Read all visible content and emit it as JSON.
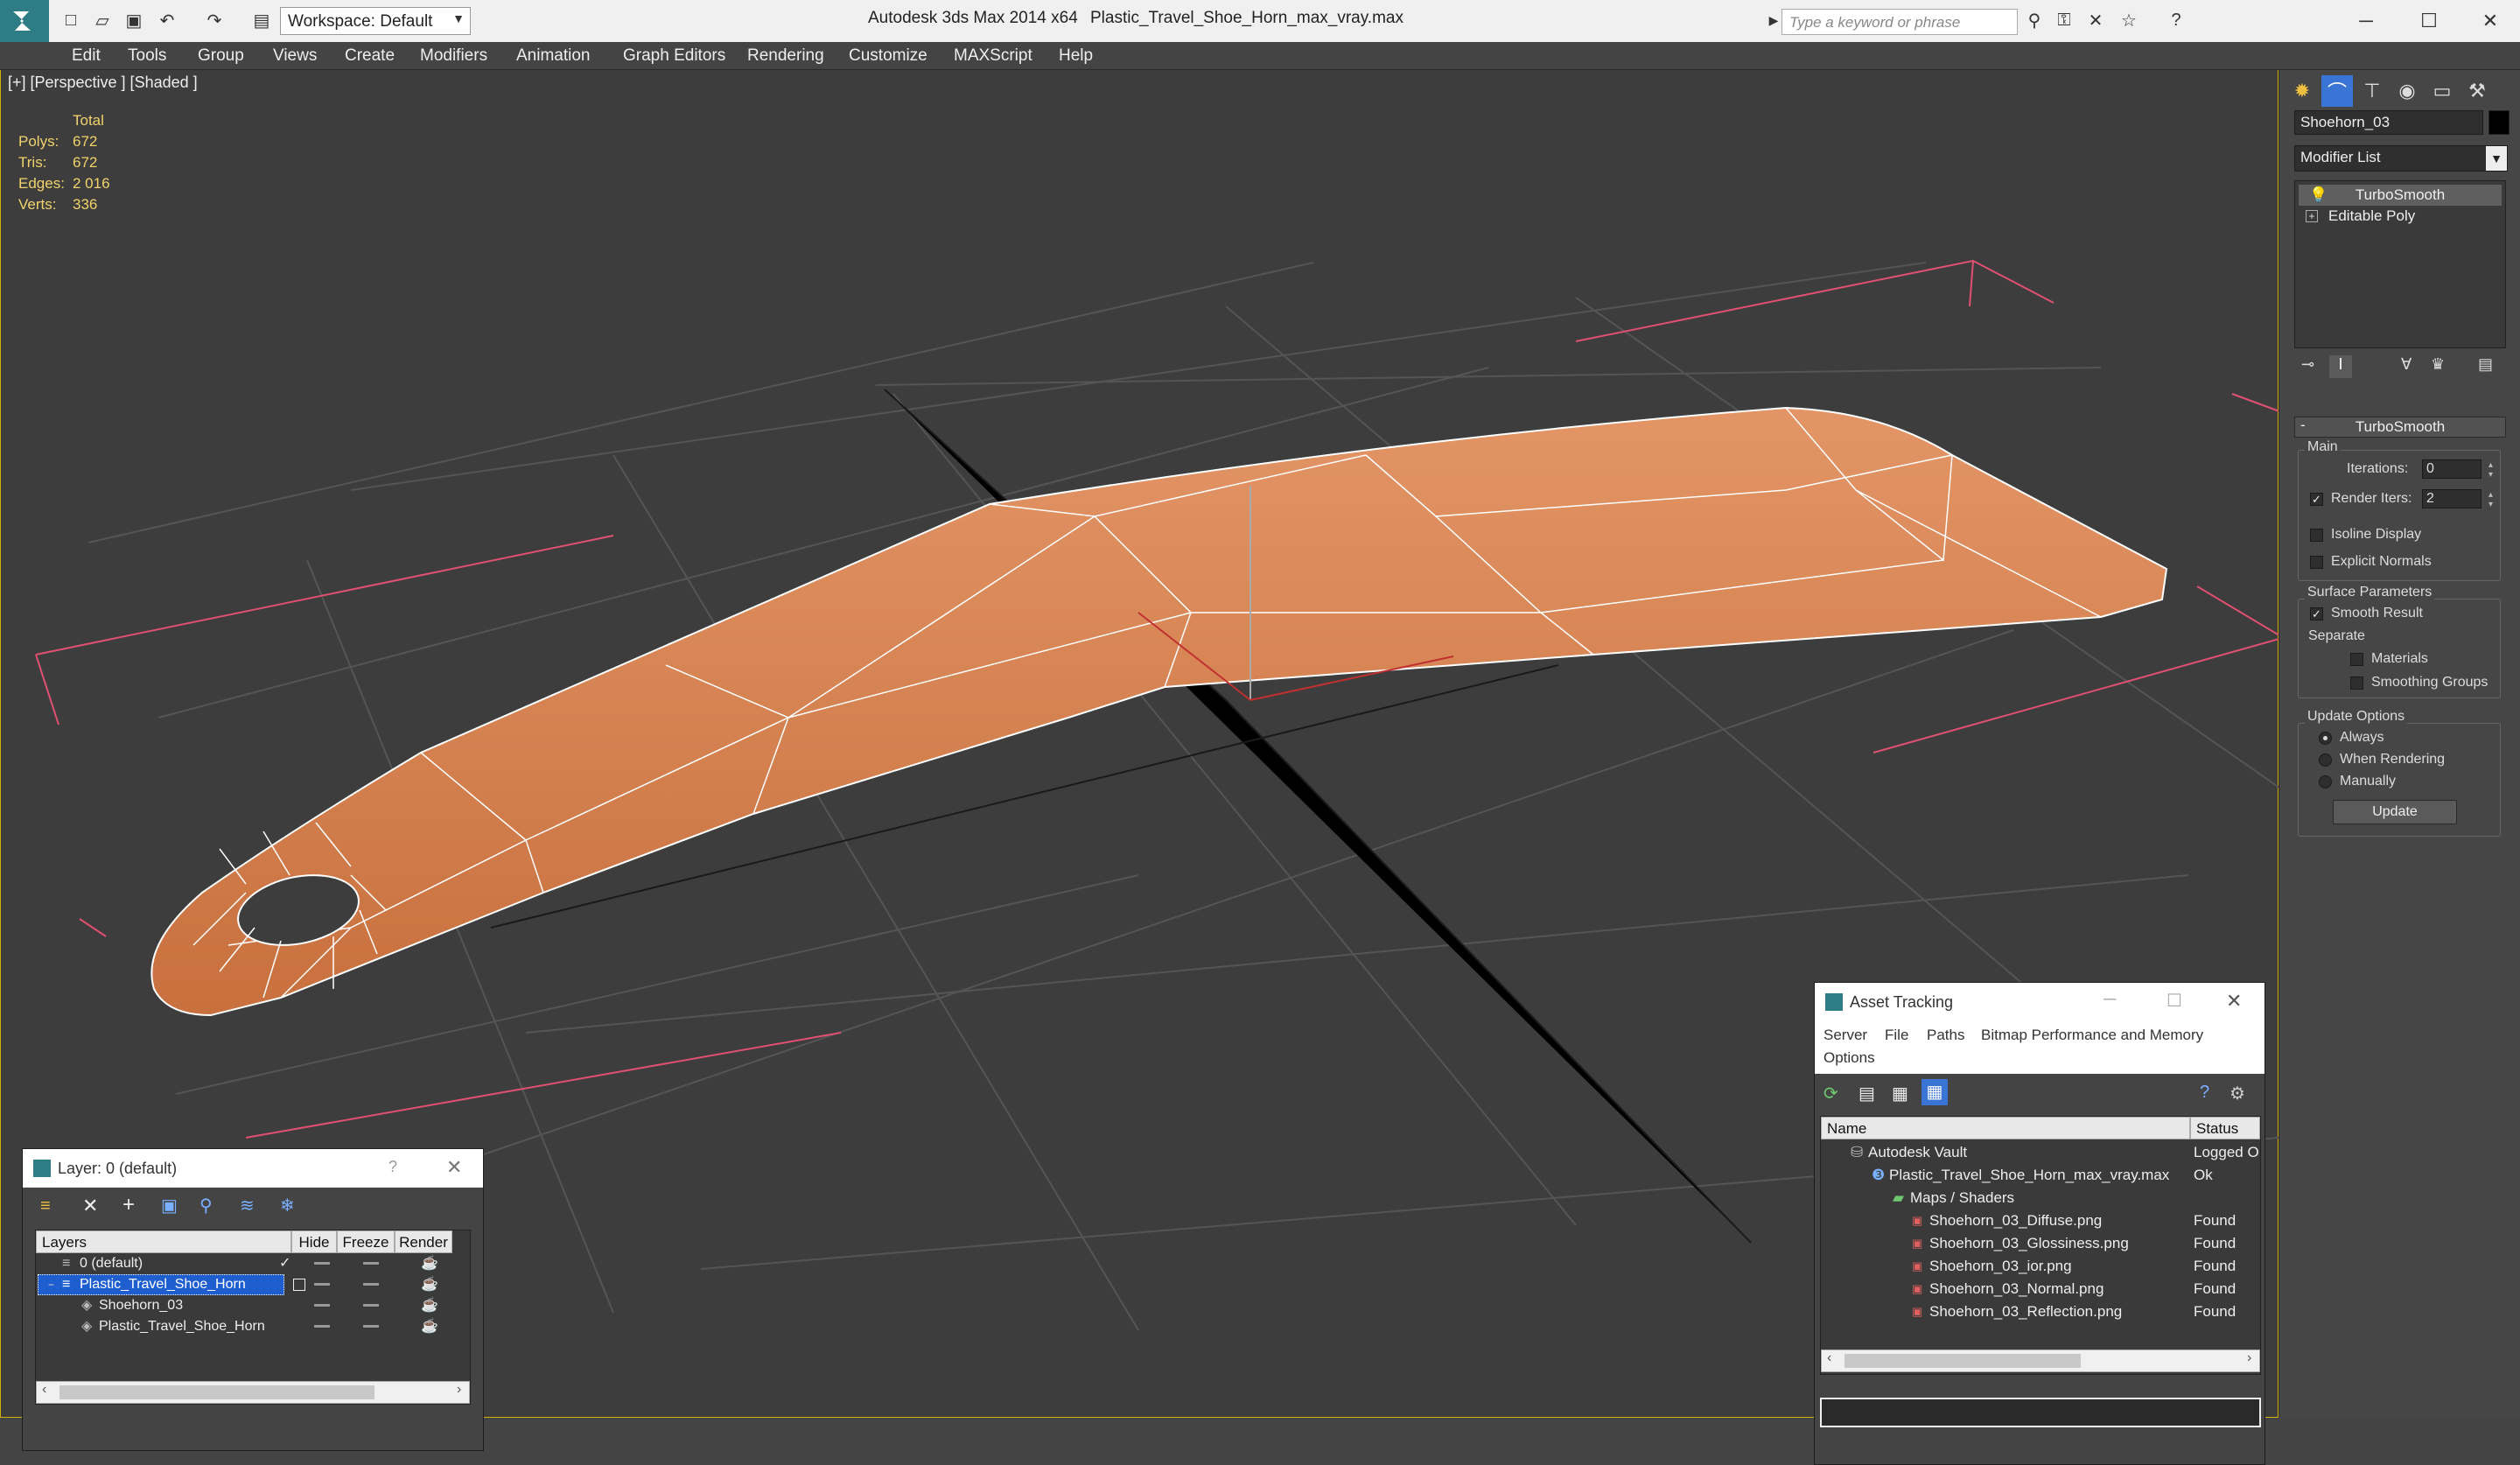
{
  "app": {
    "title": "Autodesk 3ds Max 2014 x64",
    "filename": "Plastic_Travel_Shoe_Horn_max_vray.max",
    "workspace": "Workspace: Default",
    "search_placeholder": "Type a keyword or phrase"
  },
  "menu": [
    "Edit",
    "Tools",
    "Group",
    "Views",
    "Create",
    "Modifiers",
    "Animation",
    "Graph Editors",
    "Rendering",
    "Customize",
    "MAXScript",
    "Help"
  ],
  "viewport": {
    "label": "[+] [Perspective ] [Shaded ]",
    "stats": {
      "header": "Total",
      "rows": [
        {
          "label": "Polys:",
          "value": "672"
        },
        {
          "label": "Tris:",
          "value": "672"
        },
        {
          "label": "Edges:",
          "value": "2 016"
        },
        {
          "label": "Verts:",
          "value": "336"
        }
      ]
    },
    "object_color": "#d9824f"
  },
  "command_panel": {
    "object_name": "Shoehorn_03",
    "modifier_list": "Modifier List",
    "stack": [
      "TurboSmooth",
      "Editable Poly"
    ],
    "rollout": {
      "title": "TurboSmooth",
      "main": "Main",
      "iterations_label": "Iterations:",
      "iterations_value": "0",
      "render_iters_label": "Render Iters:",
      "render_iters_value": "2",
      "render_iters_checked": true,
      "isoline_display": "Isoline Display",
      "explicit_normals": "Explicit Normals",
      "surface_parameters": "Surface Parameters",
      "smooth_result": "Smooth Result",
      "separate": "Separate",
      "materials": "Materials",
      "smoothing_groups": "Smoothing Groups",
      "update_options": "Update Options",
      "always": "Always",
      "when_rendering": "When Rendering",
      "manually": "Manually",
      "update_button": "Update"
    }
  },
  "layer_dialog": {
    "title": "Layer: 0 (default)",
    "help": "?",
    "columns": [
      "Layers",
      "Hide",
      "Freeze",
      "Render"
    ],
    "rows": [
      "0 (default)",
      "Plastic_Travel_Shoe_Horn",
      "Shoehorn_03",
      "Plastic_Travel_Shoe_Horn"
    ]
  },
  "asset_tracking": {
    "title": "Asset Tracking",
    "menu": [
      "Server",
      "File",
      "Paths",
      "Bitmap Performance and Memory",
      "Options"
    ],
    "columns": [
      "Name",
      "Status"
    ],
    "rows": [
      {
        "name": "Autodesk Vault",
        "status": "Logged O"
      },
      {
        "name": "Plastic_Travel_Shoe_Horn_max_vray.max",
        "status": "Ok"
      },
      {
        "name": "Maps / Shaders",
        "status": ""
      },
      {
        "name": "Shoehorn_03_Diffuse.png",
        "status": "Found"
      },
      {
        "name": "Shoehorn_03_Glossiness.png",
        "status": "Found"
      },
      {
        "name": "Shoehorn_03_ior.png",
        "status": "Found"
      },
      {
        "name": "Shoehorn_03_Normal.png",
        "status": "Found"
      },
      {
        "name": "Shoehorn_03_Reflection.png",
        "status": "Found"
      }
    ]
  }
}
